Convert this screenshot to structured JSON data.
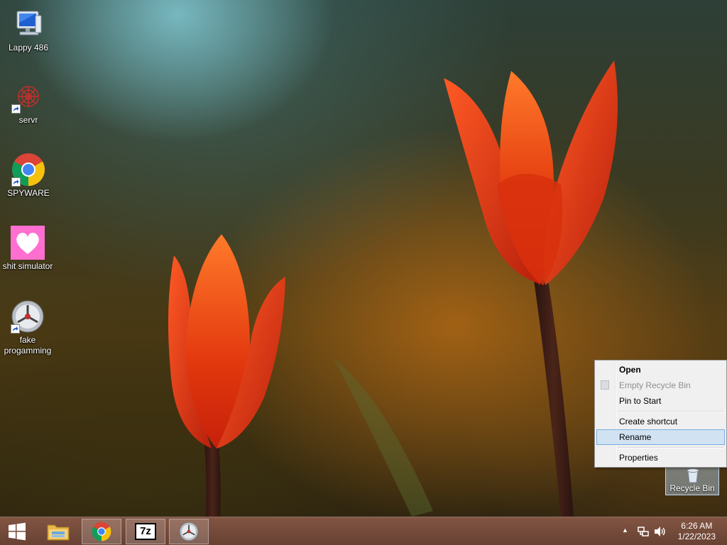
{
  "desktop": {
    "icons": [
      {
        "label": "Lappy 486",
        "icon": "computer-icon"
      },
      {
        "label": "servr",
        "icon": "servr-icon"
      },
      {
        "label": "SPYWARE",
        "icon": "chrome-icon"
      },
      {
        "label": "shit simulator",
        "icon": "heart-icon"
      },
      {
        "label": "fake progamming",
        "icon": "fake-programming-icon"
      }
    ],
    "recycle_bin": {
      "label": "Recycle Bin",
      "icon": "recycle-bin-icon"
    }
  },
  "context_menu": {
    "items": [
      {
        "label": "Open",
        "bold": true,
        "disabled": false
      },
      {
        "label": "Empty Recycle Bin",
        "disabled": true
      },
      {
        "label": "Pin to Start",
        "disabled": false
      },
      {
        "label": "Create shortcut",
        "disabled": false
      },
      {
        "label": "Rename",
        "disabled": false,
        "hovered": true
      },
      {
        "label": "Properties",
        "disabled": false
      }
    ]
  },
  "taskbar": {
    "buttons": [
      {
        "name": "start-button",
        "icon": "windows-logo-icon"
      },
      {
        "name": "file-explorer-button",
        "icon": "folder-icon"
      },
      {
        "name": "chrome-button",
        "icon": "chrome-icon",
        "active": true
      },
      {
        "name": "7zip-button",
        "icon": "7zip-icon",
        "glyph": "7z",
        "active": true
      },
      {
        "name": "app-button",
        "icon": "fake-programming-icon",
        "active": true
      }
    ],
    "tray": {
      "show_hidden": "▲",
      "network_icon": "network-icon",
      "volume_icon": "volume-icon"
    },
    "clock": {
      "time": "6:26 AM",
      "date": "1/22/2023"
    }
  },
  "colors": {
    "taskbar": "#6a3e2e",
    "menu_hover": "#d1e2f2",
    "menu_hover_border": "#78aee5"
  }
}
